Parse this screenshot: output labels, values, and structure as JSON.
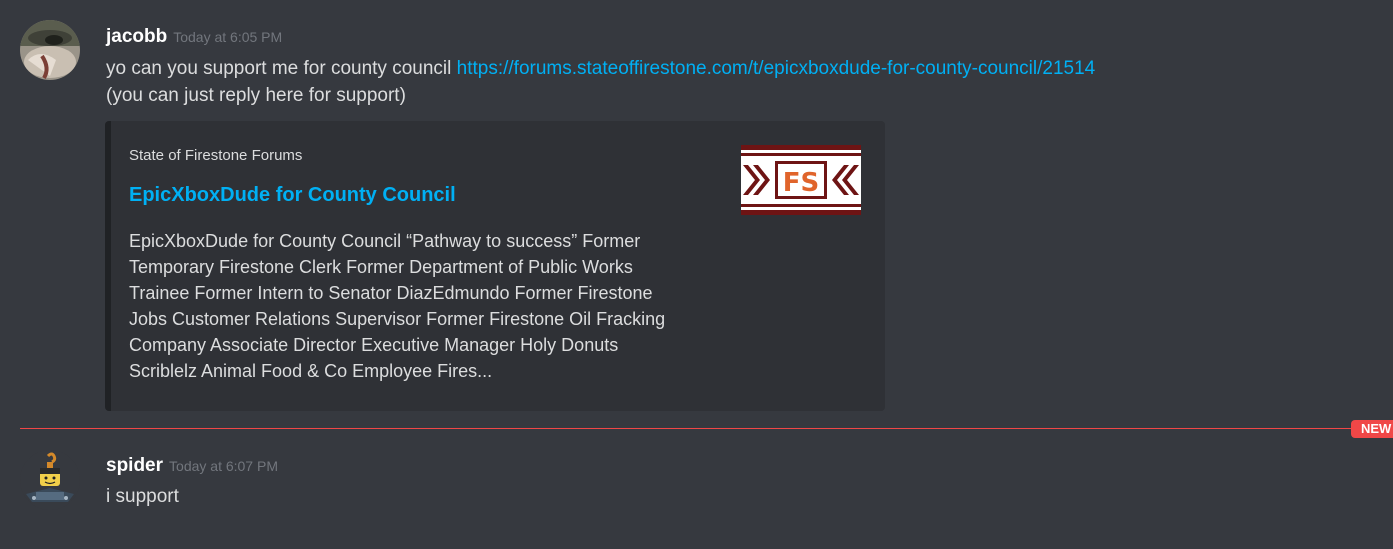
{
  "messages": [
    {
      "username": "jacobb",
      "timestamp": "Today at 6:05 PM",
      "text_before_link": "yo can you support me for county council ",
      "link": "https://forums.stateoffirestone.com/t/epicxboxdude-for-county-council/21514",
      "line2": "(you can just reply here for support)",
      "avatar_icon": "avatar-photo-icon",
      "embed": {
        "provider": "State of Firestone Forums",
        "title": "EpicXboxDude for County Council",
        "description": "EpicXboxDude for County Council “Pathway to success” Former\nTemporary Firestone Clerk Former Department of Public Works\nTrainee Former Intern to Senator DiazEdmundo Former Firestone\nJobs Customer Relations Supervisor Former Firestone Oil Fracking\nCompany Associate Director Executive Manager Holy Donuts\nScriblelz Animal Food & Co Employee Fires...",
        "thumbnail_text": "FS"
      }
    },
    {
      "username": "spider",
      "timestamp": "Today at 6:07 PM",
      "text": "i support",
      "avatar_icon": "avatar-roblox-icon"
    }
  ],
  "divider": {
    "label": "NEW",
    "color": "#f04747"
  },
  "colors": {
    "background": "#36393f",
    "embed_background": "#2f3136",
    "link": "#00b0f4",
    "username": "#ffffff",
    "timestamp": "#72767d"
  }
}
